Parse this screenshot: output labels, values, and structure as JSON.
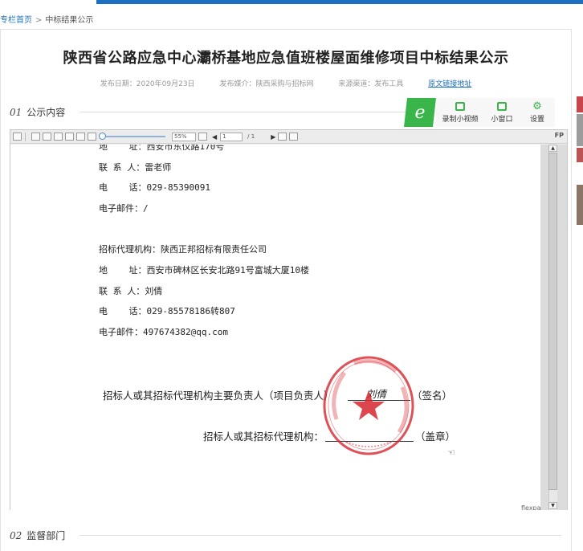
{
  "breadcrumb": {
    "home": "专栏首页",
    "sep": ">",
    "current": "中标结果公示"
  },
  "article": {
    "title": "陕西省公路应急中心灞桥基地应急值班楼屋面维修项目中标结果公示",
    "publish_date": "发布日期：2020年09月23日",
    "publish_media": "发布媒介：陕西采购与招标网",
    "source": "来源渠道：发布工具",
    "original_link": "原文链接地址"
  },
  "sections": [
    {
      "num": "01",
      "label": "公示内容"
    },
    {
      "num": "02",
      "label": "监督部门"
    }
  ],
  "float_tools": {
    "ie_label": "e",
    "record": "录制小视频",
    "mini_window": "小窗口",
    "settings": "设置"
  },
  "viewer_toolbar": {
    "zoom": "55%",
    "page_current": "1",
    "page_total": "/ 1",
    "brand_short": "FP"
  },
  "document": {
    "lines": [
      "地    址：西安市东仪路170号",
      "联 系 人：雷老师",
      "电    话：029-85390091",
      "电子邮件：/",
      "招标代理机构：陕西正邦招标有限责任公司",
      "地    址：西安市碑林区长安北路91号富城大厦10楼",
      "联 系 人：刘倩",
      "电    话：029-85578186转807",
      "电子邮件：497674382@qq.com"
    ],
    "sign_line1_prefix": "招标人或其招标代理机构主要负责人（项目负责人）",
    "sign_line1_signature": "刘倩",
    "sign_line1_suffix": "（签名）",
    "sign_line2_prefix": "招标人或其招标代理机构：",
    "sign_line2_suffix": "（盖章）",
    "stamp_text": "陕西正邦招标有限责任公司",
    "watermark": "flexpaper"
  },
  "colors": {
    "accent": "#1d6fc1",
    "tool_green": "#39b54a",
    "stamp_red": "#d7262e"
  }
}
